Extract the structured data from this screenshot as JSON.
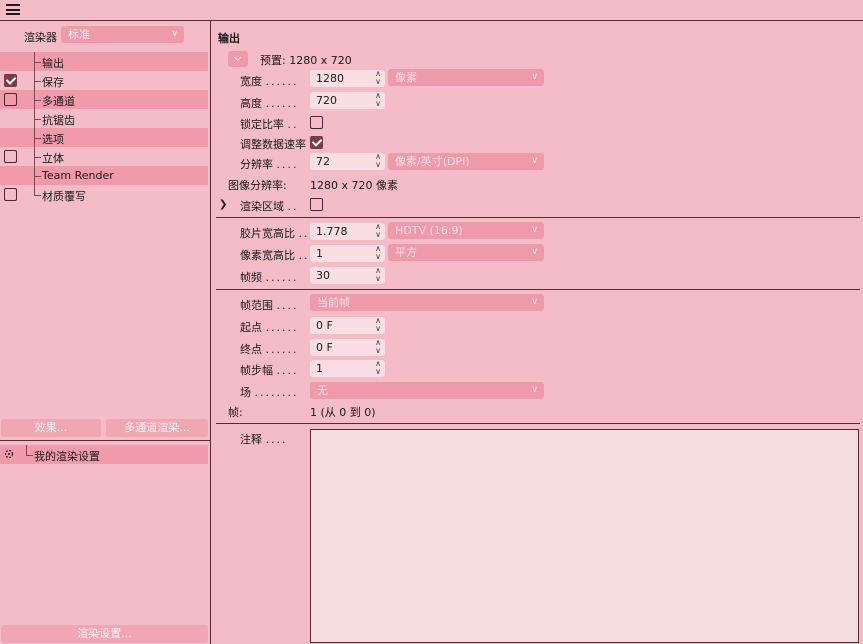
{
  "left": {
    "renderer_label": "渲染器",
    "renderer_value": "标准",
    "tree": [
      {
        "label": "输出",
        "selected": true,
        "checkbox": false,
        "checked": false
      },
      {
        "label": "保存",
        "selected": false,
        "checkbox": true,
        "checked": true
      },
      {
        "label": "多通道",
        "selected": true,
        "checkbox": true,
        "checked": false
      },
      {
        "label": "抗锯齿",
        "selected": false,
        "checkbox": false,
        "checked": false
      },
      {
        "label": "选项",
        "selected": true,
        "checkbox": false,
        "checked": false
      },
      {
        "label": "立体",
        "selected": false,
        "checkbox": true,
        "checked": false
      },
      {
        "label": "Team Render",
        "selected": true,
        "checkbox": false,
        "checked": false
      },
      {
        "label": "材质覆写",
        "selected": false,
        "checkbox": true,
        "checked": false
      }
    ],
    "effects_button": "效果...",
    "multipass_button": "多通道渲染...",
    "my_settings": "我的渲染设置",
    "render_settings_button": "渲染设置..."
  },
  "right": {
    "title": "输出",
    "preset": "预置: 1280 x 720",
    "width_label": "宽度",
    "width_value": "1280",
    "unit_value": "像素",
    "height_label": "高度",
    "height_value": "720",
    "lock_ratio_label": "锁定比率",
    "adjust_rate_label": "调整数据速率",
    "resolution_label": "分辨率",
    "resolution_value": "72",
    "resolution_unit": "像素/英寸(DPI)",
    "image_resolution_label": "图像分辨率:",
    "image_resolution_value": "1280 x 720 像素",
    "render_region_label": "渲染区域",
    "film_aspect_label": "胶片宽高比",
    "film_aspect_value": "1.778",
    "film_aspect_preset": "HDTV (16:9)",
    "pixel_aspect_label": "像素宽高比",
    "pixel_aspect_value": "1",
    "pixel_aspect_preset": "平方",
    "fps_label": "帧频",
    "fps_value": "30",
    "frame_range_label": "帧范围",
    "frame_range_value": "当前帧",
    "start_label": "起点",
    "start_value": "0 F",
    "end_label": "终点",
    "end_value": "0 F",
    "step_label": "帧步幅",
    "step_value": "1",
    "field_label": "场",
    "field_value": "无",
    "frames_label": "帧:",
    "frames_value": "1 (从 0 到 0)",
    "notes_label": "注释"
  },
  "colors": {
    "background": "#f4bcc7",
    "selected_row": "#f09aab",
    "dropdown": "#ee9aaa",
    "field": "#f9dfe3",
    "checkbox_checked": "#7a3d48"
  }
}
